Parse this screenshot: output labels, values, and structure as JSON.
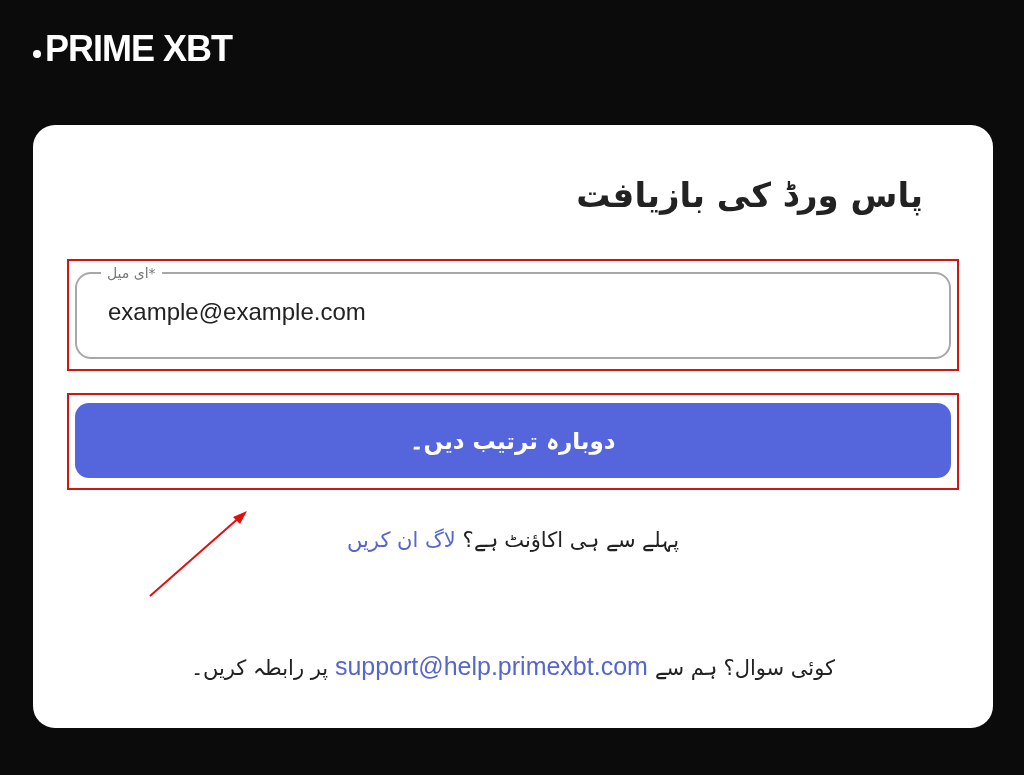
{
  "logo": {
    "text": "PRIME XBT"
  },
  "title": "پاس ورڈ کی بازیافت",
  "email_field": {
    "label": "*ای میل",
    "value": "example@example.com"
  },
  "submit_button": "دوبارہ ترتیب دیں۔",
  "login_prompt": {
    "text": "پہلے سے ہی اکاؤنٹ ہے؟",
    "link": "لاگ ان کریں"
  },
  "footer": {
    "text_start": "کوئی سوال؟ ہم سے",
    "link": "support@help.primexbt.com",
    "text_end": "پر رابطہ کریں۔"
  }
}
